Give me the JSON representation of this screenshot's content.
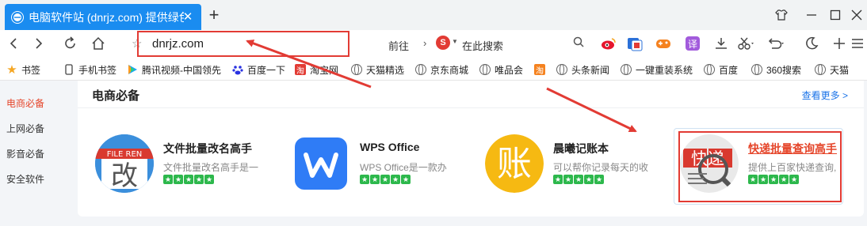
{
  "tab": {
    "title": "电脑软件站 (dnrjz.com) 提供绿色"
  },
  "address": {
    "url": "dnrjz.com",
    "go_label": "前往",
    "search_placeholder": "在此搜索"
  },
  "bookmarks": [
    {
      "label": "书签",
      "icon": "star-icon"
    },
    {
      "label": "手机书签",
      "icon": "phone-icon"
    },
    {
      "label": "腾讯视频-中国领先",
      "icon": "tencent-video-icon"
    },
    {
      "label": "百度一下",
      "icon": "baidu-icon"
    },
    {
      "label": "淘宝网",
      "icon": "taobao-icon"
    },
    {
      "label": "天猫精选",
      "icon": "globe-icon"
    },
    {
      "label": "京东商城",
      "icon": "globe-icon"
    },
    {
      "label": "唯品会",
      "icon": "globe-icon"
    },
    {
      "label": "头条新闻",
      "icon": "taobao-icon"
    },
    {
      "label": "一键重装系统",
      "icon": "globe-icon"
    },
    {
      "label": "百度",
      "icon": "globe-icon"
    },
    {
      "label": "360搜索",
      "icon": "globe-icon"
    },
    {
      "label": "天猫",
      "icon": "globe-icon"
    }
  ],
  "sidebar": {
    "items": [
      {
        "label": "电商必备",
        "active": true
      },
      {
        "label": "上网必备",
        "active": false
      },
      {
        "label": "影音必备",
        "active": false
      },
      {
        "label": "安全软件",
        "active": false
      }
    ]
  },
  "panel": {
    "title": "电商必备",
    "more": "查看更多 >",
    "apps": [
      {
        "name": "文件批量改名高手",
        "desc": "文件批量改名高手是一",
        "icon_text": "改",
        "icon_banner": "FILE REN"
      },
      {
        "name": "WPS Office",
        "desc": "WPS Office是一款办",
        "icon_text": "W"
      },
      {
        "name": "晨曦记账本",
        "desc": "可以帮你记录每天的收",
        "icon_text": "账"
      },
      {
        "name": "快递批量查询高手",
        "desc": "提供上百家快递查询,",
        "icon_text": "快递"
      }
    ]
  },
  "colors": {
    "accent": "#1a8cf0",
    "highlight": "#e23b34",
    "star": "#2db84c"
  }
}
